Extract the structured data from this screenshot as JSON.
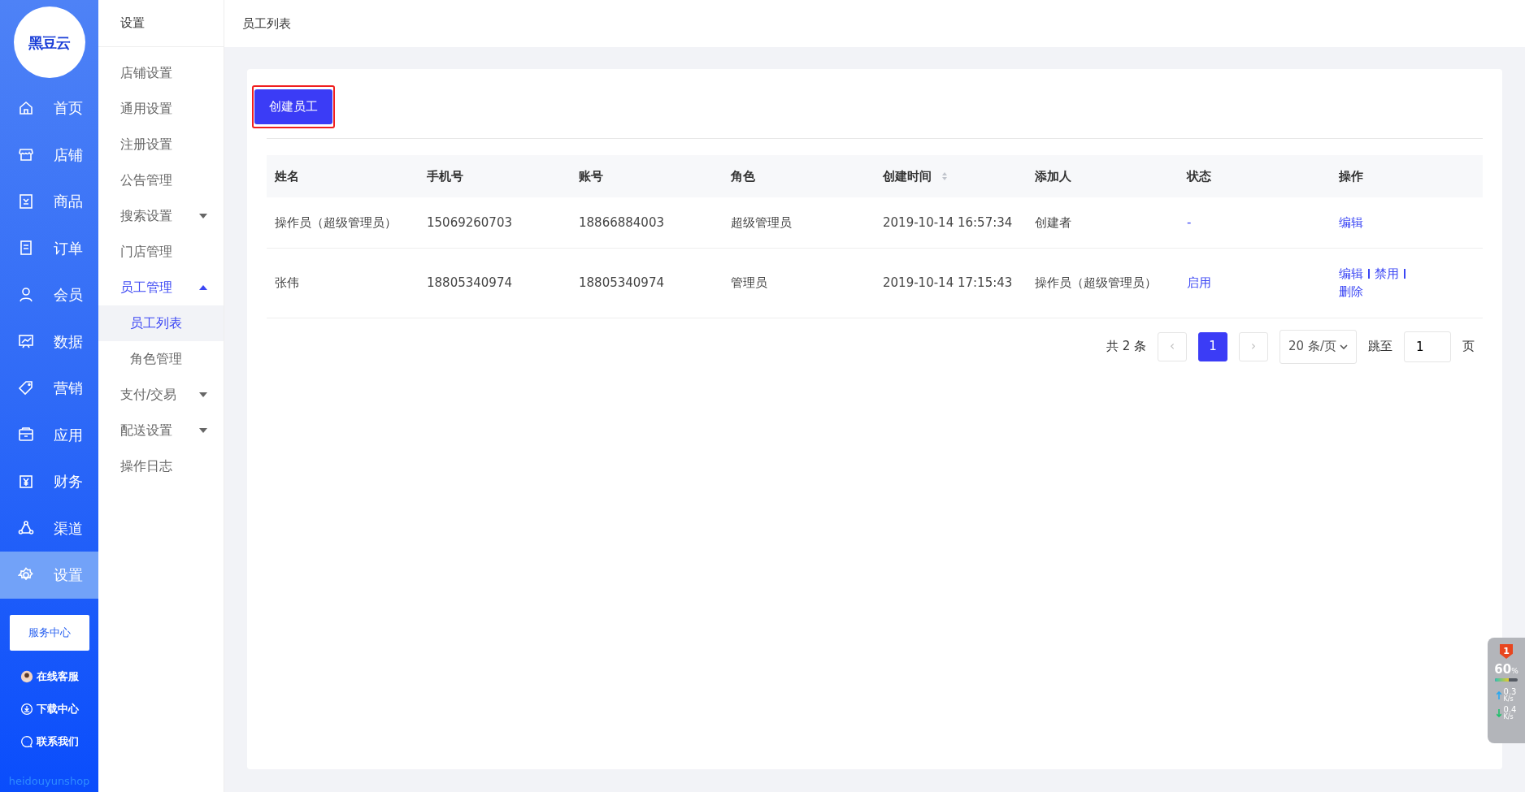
{
  "logo": {
    "text": "黑豆云"
  },
  "main_nav": [
    {
      "label": "首页",
      "selected": false
    },
    {
      "label": "店铺",
      "selected": false
    },
    {
      "label": "商品",
      "selected": false
    },
    {
      "label": "订单",
      "selected": false
    },
    {
      "label": "会员",
      "selected": false
    },
    {
      "label": "数据",
      "selected": false
    },
    {
      "label": "营销",
      "selected": false
    },
    {
      "label": "应用",
      "selected": false
    },
    {
      "label": "财务",
      "selected": false
    },
    {
      "label": "渠道",
      "selected": false
    },
    {
      "label": "设置",
      "selected": true
    }
  ],
  "service_button": "服务中心",
  "side_links": [
    {
      "label": "在线客服"
    },
    {
      "label": "下载中心"
    },
    {
      "label": "联系我们"
    }
  ],
  "brand_text": "heidouyunshop",
  "sub_nav": {
    "title": "设置",
    "items": [
      {
        "label": "店铺设置",
        "selected": false
      },
      {
        "label": "通用设置",
        "selected": false
      },
      {
        "label": "注册设置",
        "selected": false
      },
      {
        "label": "公告管理",
        "selected": false
      },
      {
        "label": "搜索设置",
        "selected": false,
        "expanded": false
      },
      {
        "label": "门店管理",
        "selected": false
      },
      {
        "label": "员工管理",
        "selected": true,
        "expanded": true,
        "children": [
          {
            "label": "员工列表",
            "selected": true
          },
          {
            "label": "角色管理",
            "selected": false
          }
        ]
      },
      {
        "label": "支付/交易",
        "selected": false,
        "expanded": false
      },
      {
        "label": "配送设置",
        "selected": false,
        "expanded": false
      },
      {
        "label": "操作日志",
        "selected": false
      }
    ]
  },
  "breadcrumb": "员工列表",
  "create_button": {
    "label": "创建员工",
    "highlighted": true
  },
  "table": {
    "columns": [
      {
        "label": "姓名"
      },
      {
        "label": "手机号"
      },
      {
        "label": "账号"
      },
      {
        "label": "角色"
      },
      {
        "label": "创建时间",
        "sortable": true
      },
      {
        "label": "添加人"
      },
      {
        "label": "状态"
      },
      {
        "label": "操作"
      }
    ],
    "rows": [
      {
        "cells": [
          "操作员（超级管理员）",
          "15069260703",
          "18866884003",
          "超级管理员",
          "2019-10-14 16:57:34",
          "创建者"
        ],
        "status": "-",
        "actions": [
          "编辑"
        ]
      },
      {
        "cells": [
          "张伟",
          "18805340974",
          "18805340974",
          "管理员",
          "2019-10-14 17:15:43",
          "操作员（超级管理员）"
        ],
        "status": "启用",
        "actions": [
          "编辑",
          "禁用",
          "删除"
        ]
      }
    ]
  },
  "pagination": {
    "total": "共 2 条",
    "prev": "‹",
    "pages": [
      {
        "label": "1",
        "selected": true
      }
    ],
    "next": "›",
    "page_size": "20 条/页",
    "jump_label": "跳至",
    "jump_value": "1",
    "page_suffix": "页"
  },
  "monitor_widget": {
    "badge": "1",
    "percent": "60",
    "percent_unit": "%",
    "level": 0.6,
    "upload": "0.3",
    "upload_unit": "K/s",
    "download": "0.4",
    "download_unit": "K/s"
  }
}
